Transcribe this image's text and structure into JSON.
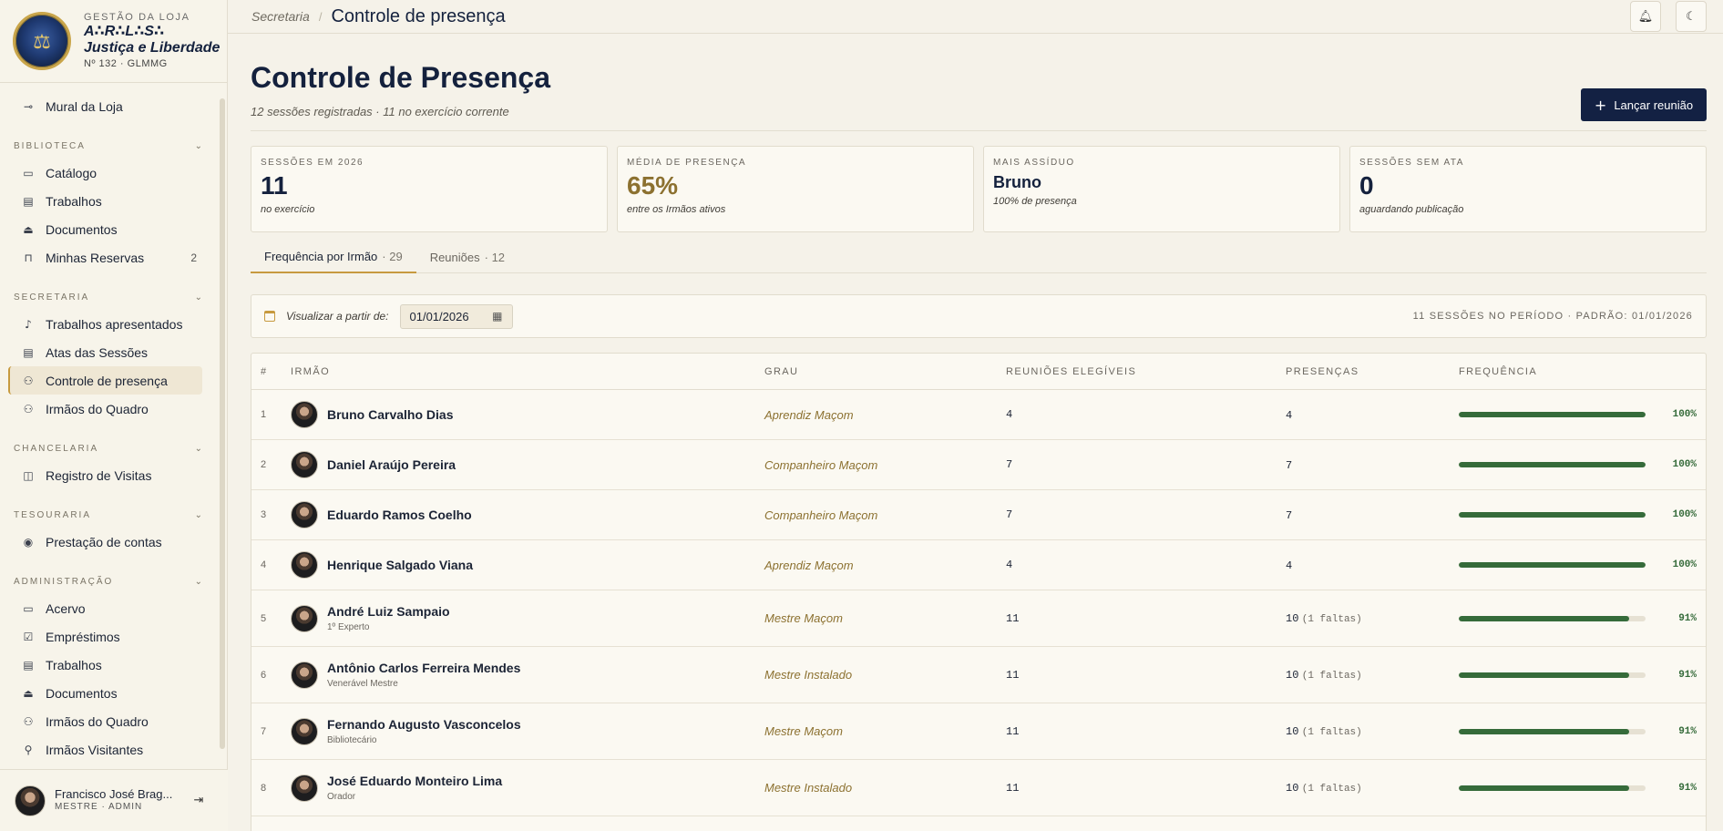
{
  "brand": {
    "kicker": "GESTÃO DA LOJA",
    "name_line1": "A∴R∴L∴S∴",
    "name_line2": "Justiça e Liberdade",
    "sub": "Nº 132 · GLMMG"
  },
  "sidebar": {
    "top_item": {
      "label": "Mural da Loja",
      "icon": "pin-icon"
    },
    "sections": [
      {
        "title": "BIBLIOTECA",
        "items": [
          {
            "label": "Catálogo",
            "icon": "book-icon"
          },
          {
            "label": "Trabalhos",
            "icon": "file-icon"
          },
          {
            "label": "Documentos",
            "icon": "stamp-icon"
          },
          {
            "label": "Minhas Reservas",
            "icon": "bookmark-icon",
            "count": "2"
          }
        ]
      },
      {
        "title": "SECRETARIA",
        "items": [
          {
            "label": "Trabalhos apresentados",
            "icon": "mic-icon"
          },
          {
            "label": "Atas das Sessões",
            "icon": "file-icon"
          },
          {
            "label": "Controle de presença",
            "icon": "users-icon",
            "active": true
          },
          {
            "label": "Irmãos do Quadro",
            "icon": "users-icon"
          }
        ]
      },
      {
        "title": "CHANCELARIA",
        "items": [
          {
            "label": "Registro de Visitas",
            "icon": "book-open-icon"
          }
        ]
      },
      {
        "title": "TESOURARIA",
        "items": [
          {
            "label": "Prestação de contas",
            "icon": "coin-icon"
          }
        ]
      },
      {
        "title": "ADMINISTRAÇÃO",
        "items": [
          {
            "label": "Acervo",
            "icon": "book-icon"
          },
          {
            "label": "Empréstimos",
            "icon": "check-file-icon"
          },
          {
            "label": "Trabalhos",
            "icon": "file-icon"
          },
          {
            "label": "Documentos",
            "icon": "stamp-icon"
          },
          {
            "label": "Irmãos do Quadro",
            "icon": "users-icon"
          },
          {
            "label": "Irmãos Visitantes",
            "icon": "user-icon"
          }
        ]
      }
    ]
  },
  "user": {
    "name": "Francisco José Brag...",
    "role": "MESTRE · ADMIN"
  },
  "topbar": {
    "parent": "Secretaria",
    "current": "Controle de presença"
  },
  "page": {
    "title": "Controle de Presença",
    "subtitle": "12 sessões registradas · 11 no exercício corrente",
    "action_label": "Lançar reunião"
  },
  "stats": [
    {
      "label": "SESSÕES EM 2026",
      "value": "11",
      "note": "no exercício"
    },
    {
      "label": "MÉDIA DE PRESENÇA",
      "value": "65%",
      "note": "entre os Irmãos ativos"
    },
    {
      "label": "MAIS ASSÍDUO",
      "value": "Bruno",
      "note": "100% de presença"
    },
    {
      "label": "SESSÕES SEM ATA",
      "value": "0",
      "note": "aguardando publicação"
    }
  ],
  "tabs": [
    {
      "label": "Frequência por Irmão",
      "count": "· 29"
    },
    {
      "label": "Reuniões",
      "count": "· 12"
    }
  ],
  "filter": {
    "label": "Visualizar a partir de:",
    "date": "01/01/2026",
    "summary": "11 SESSÕES NO PERÍODO · PADRÃO: 01/01/2026"
  },
  "table": {
    "headers": {
      "n": "#",
      "irmao": "IRMÃO",
      "grau": "GRAU",
      "reunioes": "REUNIÕES ELEGÍVEIS",
      "presencas": "PRESENÇAS",
      "frequencia": "FREQUÊNCIA"
    },
    "rows": [
      {
        "n": "1",
        "name": "Bruno Carvalho Dias",
        "role": "",
        "grau": "Aprendiz Maçom",
        "eligible": "4",
        "present": "4",
        "faltas": "",
        "pct": "100%",
        "fraction": 1.0
      },
      {
        "n": "2",
        "name": "Daniel Araújo Pereira",
        "role": "",
        "grau": "Companheiro Maçom",
        "eligible": "7",
        "present": "7",
        "faltas": "",
        "pct": "100%",
        "fraction": 1.0
      },
      {
        "n": "3",
        "name": "Eduardo Ramos Coelho",
        "role": "",
        "grau": "Companheiro Maçom",
        "eligible": "7",
        "present": "7",
        "faltas": "",
        "pct": "100%",
        "fraction": 1.0
      },
      {
        "n": "4",
        "name": "Henrique Salgado Viana",
        "role": "",
        "grau": "Aprendiz Maçom",
        "eligible": "4",
        "present": "4",
        "faltas": "",
        "pct": "100%",
        "fraction": 1.0
      },
      {
        "n": "5",
        "name": "André Luiz Sampaio",
        "role": "1º Experto",
        "grau": "Mestre Maçom",
        "eligible": "11",
        "present": "10",
        "faltas": "(1 faltas)",
        "pct": "91%",
        "fraction": 0.91
      },
      {
        "n": "6",
        "name": "Antônio Carlos Ferreira Mendes",
        "role": "Venerável Mestre",
        "grau": "Mestre Instalado",
        "eligible": "11",
        "present": "10",
        "faltas": "(1 faltas)",
        "pct": "91%",
        "fraction": 0.91
      },
      {
        "n": "7",
        "name": "Fernando Augusto Vasconcelos",
        "role": "Bibliotecário",
        "grau": "Mestre Maçom",
        "eligible": "11",
        "present": "10",
        "faltas": "(1 faltas)",
        "pct": "91%",
        "fraction": 0.91
      },
      {
        "n": "8",
        "name": "José Eduardo Monteiro Lima",
        "role": "Orador",
        "grau": "Mestre Instalado",
        "eligible": "11",
        "present": "10",
        "faltas": "(1 faltas)",
        "pct": "91%",
        "fraction": 0.91
      }
    ]
  },
  "colors": {
    "navy": "#132143",
    "gold": "#8c7130",
    "accent": "#c79a3f",
    "green": "#356b3a"
  }
}
